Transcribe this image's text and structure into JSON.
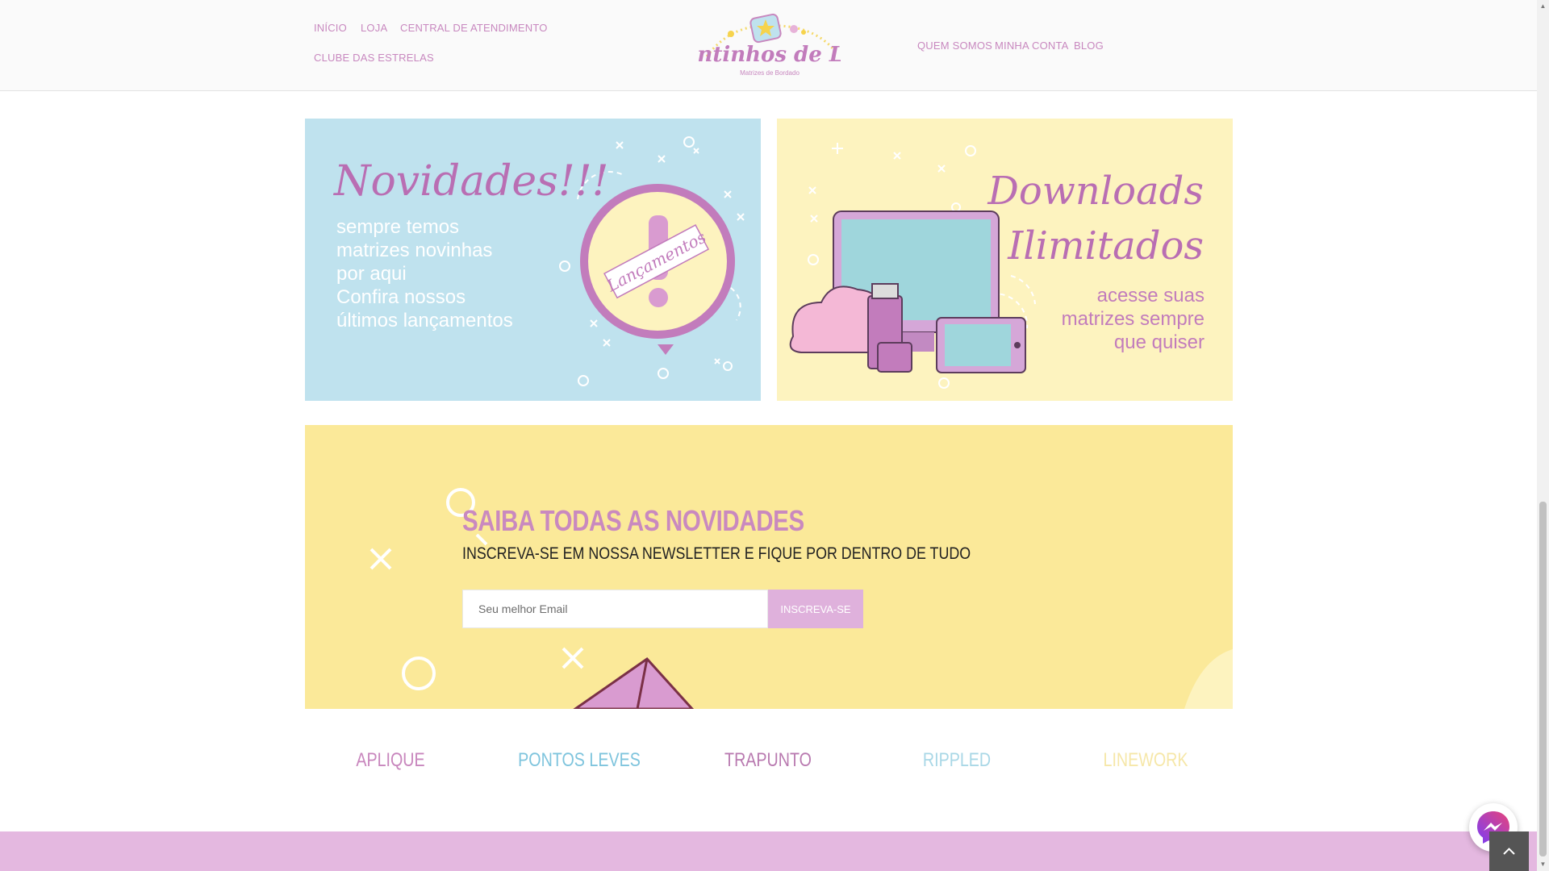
{
  "header": {
    "nav_left": [
      "INÍCIO",
      "LOJA",
      "CENTRAL DE ATENDIMENTO",
      "CLUBE DAS ESTRELAS"
    ],
    "nav_right": [
      "QUEM SOMOS",
      "MINHA CONTA",
      "BLOG"
    ],
    "logo": {
      "name": "Pontinhos de Luz",
      "tagline": "Matrizes de Bordado"
    }
  },
  "banners": {
    "launches": {
      "title": "Novidades!!!",
      "lines": [
        "sempre temos",
        "matrizes novinhas",
        "por aqui",
        "Confira nossos",
        "últimos lançamentos"
      ],
      "badge": "Lançamentos"
    },
    "downloads": {
      "title_lines": [
        "Downloads",
        "Ilimitados"
      ],
      "lines": [
        "acesse suas",
        "matrizes sempre",
        "que quiser"
      ]
    }
  },
  "newsletter": {
    "title": "SAIBA TODAS AS NOVIDADES",
    "subtitle": "INSCREVA-SE EM NOSSA NEWSLETTER E FIQUE POR DENTRO DE TUDO",
    "email_placeholder": "Seu melhor Email",
    "submit_label": "INSCREVA-SE"
  },
  "categories": [
    {
      "label": "APLIQUE",
      "color": "#c886bd"
    },
    {
      "label": "PONTOS LEVES",
      "color": "#7ec4dd"
    },
    {
      "label": "TRAPUNTO",
      "color": "#b97ab0"
    },
    {
      "label": "RIPPLED",
      "color": "#a8d7e6"
    },
    {
      "label": "LINEWORK",
      "color": "#f6e7a8"
    }
  ],
  "colors": {
    "nav": "#c888bf",
    "accent_pink": "#dfb1dc",
    "banner_blue": "#bfe2ee",
    "banner_yellow": "#fdf3bf",
    "newsletter_bg": "#fbe999",
    "footer": "#e4b8e0"
  },
  "icons": [
    "messenger-icon",
    "chevron-up-icon"
  ]
}
